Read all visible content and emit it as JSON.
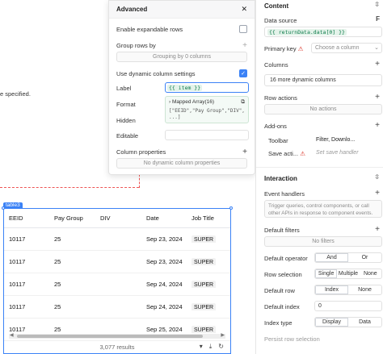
{
  "canvas": {
    "note": "e specified."
  },
  "table": {
    "tag": "table3",
    "columns": [
      "EEID",
      "Pay Group",
      "DIV",
      "Date",
      "Job Title"
    ],
    "rows": [
      [
        "10117",
        "25",
        "",
        "Sep 23, 2024",
        "SUPER"
      ],
      [
        "10117",
        "25",
        "",
        "Sep 23, 2024",
        "SUPER"
      ],
      [
        "10117",
        "25",
        "",
        "Sep 24, 2024",
        "SUPER"
      ],
      [
        "10117",
        "25",
        "",
        "Sep 24, 2024",
        "SUPER"
      ],
      [
        "10117",
        "25",
        "",
        "Sep 25, 2024",
        "SUPER"
      ]
    ],
    "footer": "3,077 results",
    "icons": [
      "filter-icon",
      "download-icon",
      "refresh-icon"
    ]
  },
  "advanced": {
    "title": "Advanced",
    "expandable_rows": "Enable expandable rows",
    "group_rows": "Group rows by",
    "grouping_btn": "Grouping by 0 columns",
    "dynamic_settings": "Use dynamic column settings",
    "label": "Label",
    "label_value": "{{ item }}",
    "format": "Format",
    "hidden": "Hidden",
    "editable": "Editable",
    "preview_title": "Mapped Array(16)",
    "preview_value": "[\"EEID\",\"Pay Group\",\"DIV\", ...]",
    "column_properties": "Column properties",
    "no_props": "No dynamic column properties"
  },
  "panel": {
    "content": "Content",
    "data_source": "Data source",
    "data_source_value": "{{ returnData.data[0] }}",
    "primary_key": "Primary key",
    "primary_key_placeholder": "Choose a column",
    "columns": "Columns",
    "columns_value": "16 more dynamic columns",
    "row_actions": "Row actions",
    "no_actions": "No actions",
    "addons": "Add-ons",
    "toolbar": "Toolbar",
    "toolbar_value": "Filter, Downlo...",
    "save_actions": "Save acti...",
    "save_handler": "Set save handler",
    "interaction": "Interaction",
    "event_handlers": "Event handlers",
    "event_help": "Trigger queries, control components, or call other APIs in response to component events.",
    "default_filters": "Default filters",
    "no_filters": "No filters",
    "default_operator": "Default operator",
    "op_and": "And",
    "op_or": "Or",
    "row_selection": "Row selection",
    "sel_single": "Single",
    "sel_multiple": "Multiple",
    "sel_none": "None",
    "default_row": "Default row",
    "row_index": "Index",
    "row_none": "None",
    "default_index": "Default index",
    "default_index_value": "0",
    "index_type": "Index type",
    "type_display": "Display",
    "type_data": "Data",
    "persist_row": "Persist row selection"
  }
}
